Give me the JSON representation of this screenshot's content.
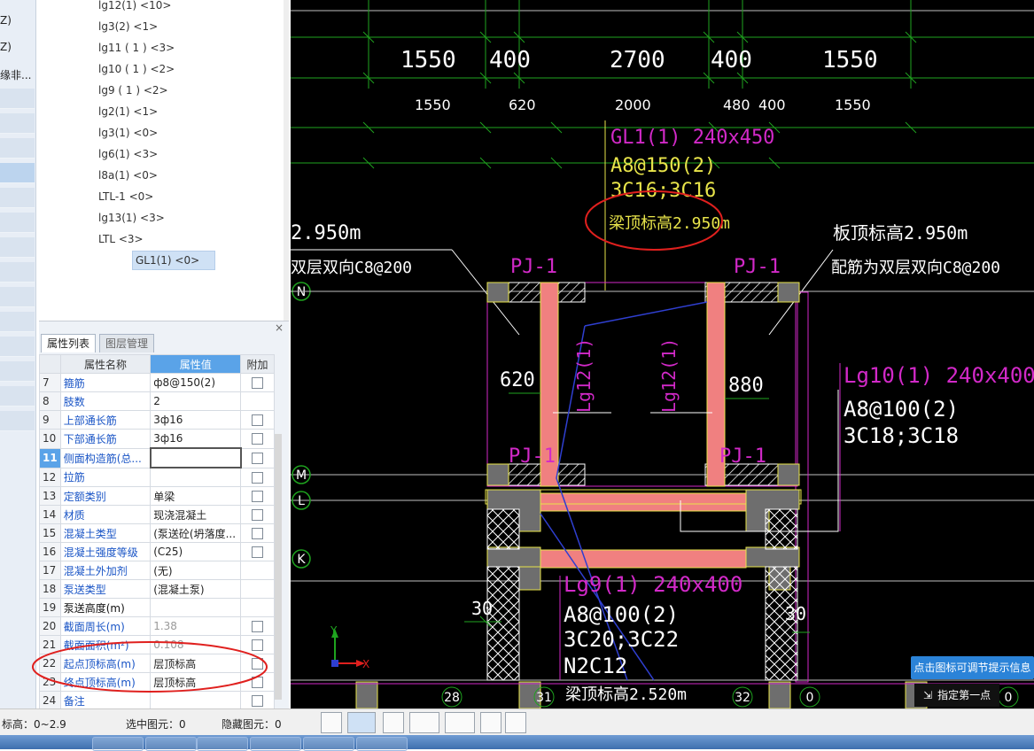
{
  "strip": {
    "texts": [
      "Z)",
      "Z)",
      "缘非..."
    ]
  },
  "tree": {
    "items": [
      "lg12(1) <10>",
      "lg3(2) <1>",
      "lg11 ( 1 ) <3>",
      "lg10 ( 1 ) <2>",
      "lg9 ( 1 ) <2>",
      "lg2(1) <1>",
      "lg3(1) <0>",
      "lg6(1) <3>",
      "l8a(1) <0>",
      "LTL-1 <0>",
      "lg13(1) <3>",
      "LTL <3>",
      "GL1(1) <0>"
    ],
    "selected_index": 12
  },
  "panel": {
    "close_icon": "×",
    "tab_properties": "属性列表",
    "tab_layers": "图层管理",
    "col_name": "属性名称",
    "col_value": "属性值",
    "col_extra": "附加",
    "rows": [
      {
        "n": "7",
        "name": "箍筋",
        "value": "ф8@150(2)",
        "check": true
      },
      {
        "n": "8",
        "name": "肢数",
        "value": "2",
        "check": false
      },
      {
        "n": "9",
        "name": "上部通长筋",
        "value": "3ф16",
        "check": true
      },
      {
        "n": "10",
        "name": "下部通长筋",
        "value": "3ф16",
        "check": true
      },
      {
        "n": "11",
        "name": "侧面构造筋(总...",
        "value": "",
        "check": true,
        "editing": true
      },
      {
        "n": "12",
        "name": "拉筋",
        "value": "",
        "check": true
      },
      {
        "n": "13",
        "name": "定额类别",
        "value": "单梁",
        "check": true
      },
      {
        "n": "14",
        "name": "材质",
        "value": "现浇混凝土",
        "check": true
      },
      {
        "n": "15",
        "name": "混凝土类型",
        "value": "(泵送砼(坍落度...",
        "check": true
      },
      {
        "n": "16",
        "name": "混凝土强度等级",
        "value": "(C25)",
        "check": true
      },
      {
        "n": "17",
        "name": "混凝土外加剂",
        "value": "(无)",
        "check": false
      },
      {
        "n": "18",
        "name": "泵送类型",
        "value": "(混凝土泵)",
        "check": false
      },
      {
        "n": "19",
        "name": "泵送高度(m)",
        "value": "",
        "check": false,
        "plain": true
      },
      {
        "n": "20",
        "name": "截面周长(m)",
        "value": "1.38",
        "check": true,
        "grey": true
      },
      {
        "n": "21",
        "name": "截面面积(m²)",
        "value": "0.108",
        "check": true,
        "grey": true
      },
      {
        "n": "22",
        "name": "起点顶标高(m)",
        "value": "层顶标高",
        "check": true
      },
      {
        "n": "23",
        "name": "终点顶标高(m)",
        "value": "层顶标高",
        "check": true
      },
      {
        "n": "24",
        "name": "备注",
        "value": "",
        "check": true
      }
    ]
  },
  "drawing": {
    "top_dims": [
      "1550",
      "400",
      "2700",
      "400",
      "1550"
    ],
    "sub_dims": [
      "1550",
      "620",
      "2000",
      "480",
      "400",
      "1550"
    ],
    "beam_gl1_name": "GL1(1) 240x450",
    "beam_gl1_stirrup": "A8@150(2)",
    "beam_gl1_bars": "3C16;3C16",
    "beam_gl1_elev": "梁顶标高2.950m",
    "left_elev": "2.950m",
    "left_slab": "双层双向C8@200",
    "right_elev": "板顶标高2.950m",
    "right_slab": "配筋为双层双向C8@200",
    "pj_labels": [
      "PJ-1",
      "PJ-1",
      "PJ-1",
      "PJ-1"
    ],
    "lg12_label": "Lg12(1)",
    "dim_620": "620",
    "dim_880": "880",
    "lg10_name": "Lg10(1) 240x400",
    "lg10_stirrup": "A8@100(2)",
    "lg10_bars": "3C18;3C18",
    "lg9_name": "Lg9(1) 240x400",
    "lg9_stirrup": "A8@100(2)",
    "lg9_bars": "3C20;3C22",
    "lg9_n": "N2C12",
    "bottom_elev": "梁顶标高2.520m",
    "dim_30_left": "30",
    "dim_30_right": "30",
    "axis_labels": [
      "N",
      "M",
      "L",
      "K"
    ],
    "bottom_axis": [
      "28",
      "31",
      "32",
      "0",
      "0"
    ],
    "ucs_x": "X",
    "ucs_y": "Y"
  },
  "tooltip": "点击图标可调节提示信息",
  "pick_point": "指定第一点",
  "status": {
    "elev": "标高：0~2.9",
    "selected": "选中图元：0",
    "hidden": "隐藏图元：0"
  },
  "colors": {
    "magenta": "#d229c8",
    "yellow": "#e8e44a",
    "white": "#ffffff",
    "green": "#1fa31f",
    "beam_fill": "#f08080",
    "red_annotation": "#e0201e",
    "accent": "#2b83d8"
  }
}
